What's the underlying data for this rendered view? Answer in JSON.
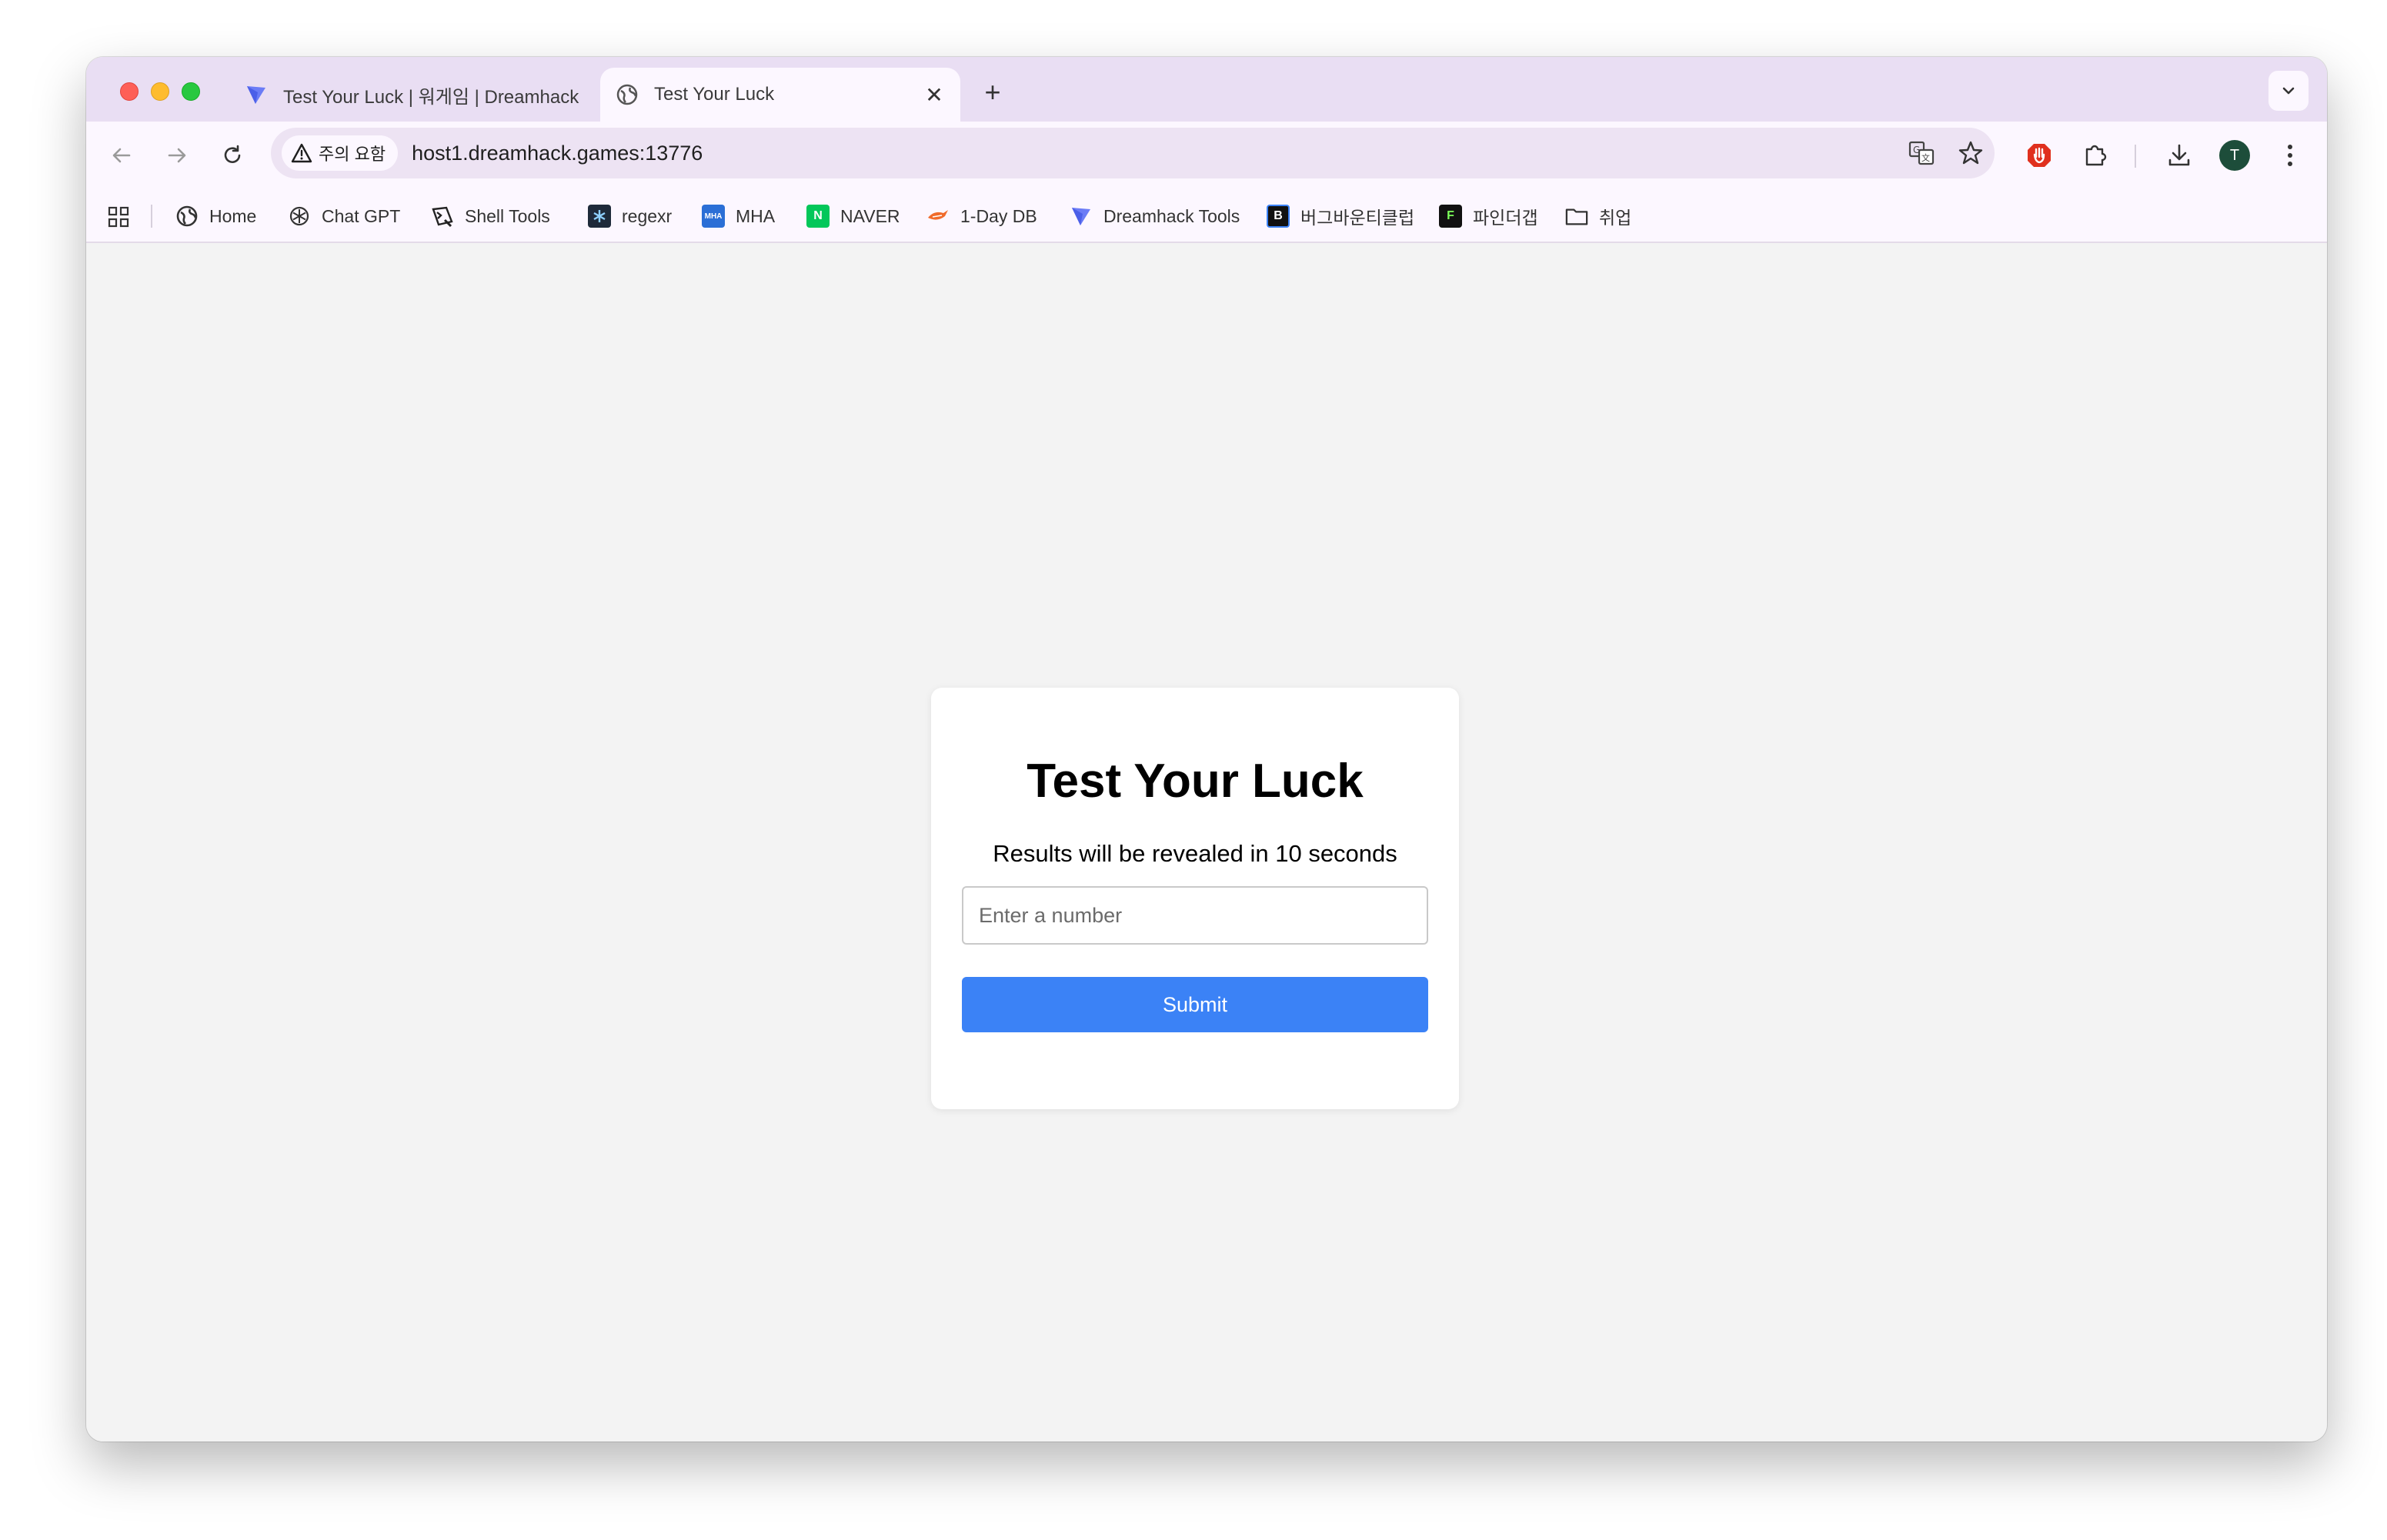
{
  "tabs": [
    {
      "title": "Test Your Luck | 워게임 | Dreamhack",
      "favicon": "dreamhack-icon",
      "active": false
    },
    {
      "title": "Test Your Luck",
      "favicon": "globe-icon",
      "active": true
    }
  ],
  "toolbar": {
    "security_label": "주의 요함",
    "url": "host1.dreamhack.games:13776",
    "avatar_initial": "T"
  },
  "bookmarks": [
    {
      "label": "Home",
      "icon": "globe-icon"
    },
    {
      "label": "Chat GPT",
      "icon": "openai-icon"
    },
    {
      "label": "Shell Tools",
      "icon": "shell-tools-icon"
    },
    {
      "label": "regexr",
      "icon": "regexr-icon"
    },
    {
      "label": "MHA",
      "icon": "mha-icon"
    },
    {
      "label": "NAVER",
      "icon": "naver-icon"
    },
    {
      "label": "1-Day DB",
      "icon": "1day-db-icon"
    },
    {
      "label": "Dreamhack Tools",
      "icon": "dreamhack-icon"
    },
    {
      "label": "버그바운티클럽",
      "icon": "bugbounty-icon"
    },
    {
      "label": "파인더갭",
      "icon": "findthegap-icon"
    },
    {
      "label": "취업",
      "icon": "folder-icon"
    }
  ],
  "page": {
    "heading": "Test Your Luck",
    "subtitle": "Results will be revealed in 10 seconds",
    "input_placeholder": "Enter a number",
    "input_value": "",
    "submit_label": "Submit"
  },
  "colors": {
    "accent": "#3b82f6",
    "tabstrip": "#e9def3",
    "toolbar": "#fcf7ff",
    "content_bg": "#f3f3f3"
  }
}
